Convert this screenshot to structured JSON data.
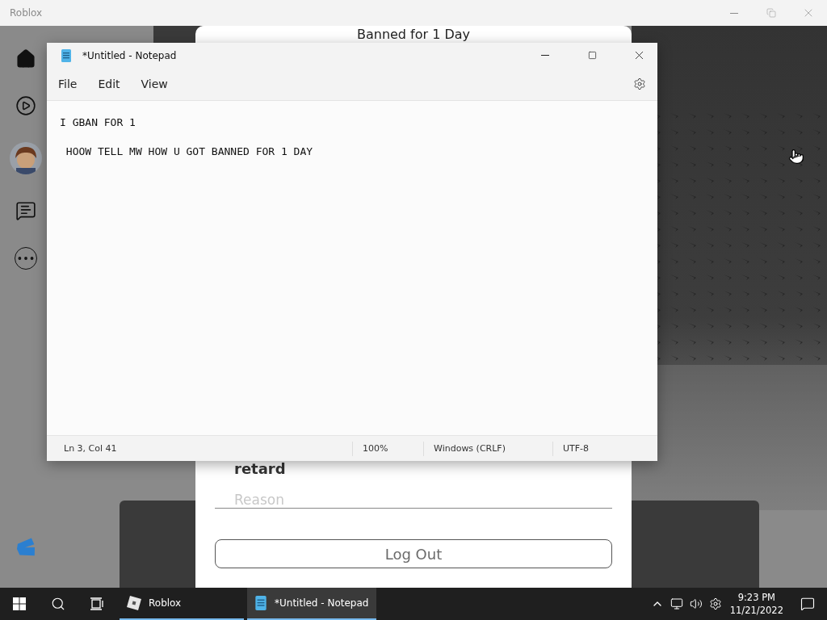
{
  "app_window": {
    "title": "Roblox"
  },
  "ban_dialog": {
    "title": "Banned for 1 Day",
    "note": "retard",
    "reason_label": "Reason",
    "button": "Log Out"
  },
  "notepad": {
    "title": "*Untitled - Notepad",
    "menu": [
      "File",
      "Edit",
      "View"
    ],
    "content": "I GBAN FOR 1\n\n HOOW TELL MW HOW U GOT BANNED FOR 1 DAY",
    "status_bar": [
      "Ln 3, Col 41",
      "100%",
      "Windows (CRLF)",
      "UTF-8"
    ]
  },
  "taskbar": {
    "apps": [
      {
        "kind": "roblox",
        "label": "Roblox",
        "selected": false
      },
      {
        "kind": "notepad",
        "label": "*Untitled - Notepad",
        "selected": true
      }
    ],
    "clock": {
      "time": "9:23 PM",
      "date": "11/21/2022"
    }
  }
}
